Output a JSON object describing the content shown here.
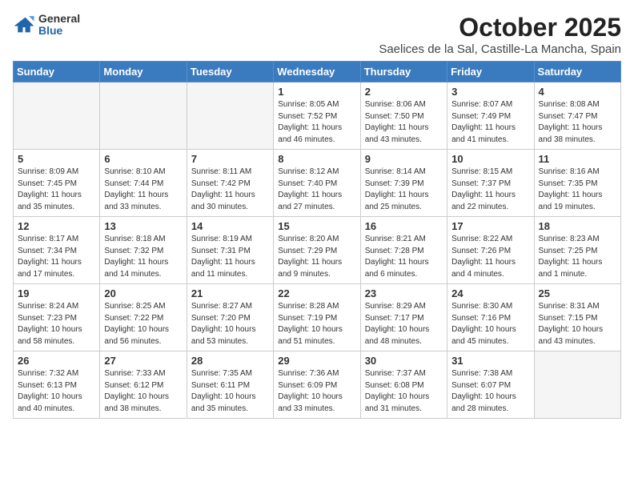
{
  "header": {
    "logo_general": "General",
    "logo_blue": "Blue",
    "month": "October 2025",
    "location": "Saelices de la Sal, Castille-La Mancha, Spain"
  },
  "weekdays": [
    "Sunday",
    "Monday",
    "Tuesday",
    "Wednesday",
    "Thursday",
    "Friday",
    "Saturday"
  ],
  "rows": [
    [
      {
        "day": "",
        "info": ""
      },
      {
        "day": "",
        "info": ""
      },
      {
        "day": "",
        "info": ""
      },
      {
        "day": "1",
        "info": "Sunrise: 8:05 AM\nSunset: 7:52 PM\nDaylight: 11 hours\nand 46 minutes."
      },
      {
        "day": "2",
        "info": "Sunrise: 8:06 AM\nSunset: 7:50 PM\nDaylight: 11 hours\nand 43 minutes."
      },
      {
        "day": "3",
        "info": "Sunrise: 8:07 AM\nSunset: 7:49 PM\nDaylight: 11 hours\nand 41 minutes."
      },
      {
        "day": "4",
        "info": "Sunrise: 8:08 AM\nSunset: 7:47 PM\nDaylight: 11 hours\nand 38 minutes."
      }
    ],
    [
      {
        "day": "5",
        "info": "Sunrise: 8:09 AM\nSunset: 7:45 PM\nDaylight: 11 hours\nand 35 minutes."
      },
      {
        "day": "6",
        "info": "Sunrise: 8:10 AM\nSunset: 7:44 PM\nDaylight: 11 hours\nand 33 minutes."
      },
      {
        "day": "7",
        "info": "Sunrise: 8:11 AM\nSunset: 7:42 PM\nDaylight: 11 hours\nand 30 minutes."
      },
      {
        "day": "8",
        "info": "Sunrise: 8:12 AM\nSunset: 7:40 PM\nDaylight: 11 hours\nand 27 minutes."
      },
      {
        "day": "9",
        "info": "Sunrise: 8:14 AM\nSunset: 7:39 PM\nDaylight: 11 hours\nand 25 minutes."
      },
      {
        "day": "10",
        "info": "Sunrise: 8:15 AM\nSunset: 7:37 PM\nDaylight: 11 hours\nand 22 minutes."
      },
      {
        "day": "11",
        "info": "Sunrise: 8:16 AM\nSunset: 7:35 PM\nDaylight: 11 hours\nand 19 minutes."
      }
    ],
    [
      {
        "day": "12",
        "info": "Sunrise: 8:17 AM\nSunset: 7:34 PM\nDaylight: 11 hours\nand 17 minutes."
      },
      {
        "day": "13",
        "info": "Sunrise: 8:18 AM\nSunset: 7:32 PM\nDaylight: 11 hours\nand 14 minutes."
      },
      {
        "day": "14",
        "info": "Sunrise: 8:19 AM\nSunset: 7:31 PM\nDaylight: 11 hours\nand 11 minutes."
      },
      {
        "day": "15",
        "info": "Sunrise: 8:20 AM\nSunset: 7:29 PM\nDaylight: 11 hours\nand 9 minutes."
      },
      {
        "day": "16",
        "info": "Sunrise: 8:21 AM\nSunset: 7:28 PM\nDaylight: 11 hours\nand 6 minutes."
      },
      {
        "day": "17",
        "info": "Sunrise: 8:22 AM\nSunset: 7:26 PM\nDaylight: 11 hours\nand 4 minutes."
      },
      {
        "day": "18",
        "info": "Sunrise: 8:23 AM\nSunset: 7:25 PM\nDaylight: 11 hours\nand 1 minute."
      }
    ],
    [
      {
        "day": "19",
        "info": "Sunrise: 8:24 AM\nSunset: 7:23 PM\nDaylight: 10 hours\nand 58 minutes."
      },
      {
        "day": "20",
        "info": "Sunrise: 8:25 AM\nSunset: 7:22 PM\nDaylight: 10 hours\nand 56 minutes."
      },
      {
        "day": "21",
        "info": "Sunrise: 8:27 AM\nSunset: 7:20 PM\nDaylight: 10 hours\nand 53 minutes."
      },
      {
        "day": "22",
        "info": "Sunrise: 8:28 AM\nSunset: 7:19 PM\nDaylight: 10 hours\nand 51 minutes."
      },
      {
        "day": "23",
        "info": "Sunrise: 8:29 AM\nSunset: 7:17 PM\nDaylight: 10 hours\nand 48 minutes."
      },
      {
        "day": "24",
        "info": "Sunrise: 8:30 AM\nSunset: 7:16 PM\nDaylight: 10 hours\nand 45 minutes."
      },
      {
        "day": "25",
        "info": "Sunrise: 8:31 AM\nSunset: 7:15 PM\nDaylight: 10 hours\nand 43 minutes."
      }
    ],
    [
      {
        "day": "26",
        "info": "Sunrise: 7:32 AM\nSunset: 6:13 PM\nDaylight: 10 hours\nand 40 minutes."
      },
      {
        "day": "27",
        "info": "Sunrise: 7:33 AM\nSunset: 6:12 PM\nDaylight: 10 hours\nand 38 minutes."
      },
      {
        "day": "28",
        "info": "Sunrise: 7:35 AM\nSunset: 6:11 PM\nDaylight: 10 hours\nand 35 minutes."
      },
      {
        "day": "29",
        "info": "Sunrise: 7:36 AM\nSunset: 6:09 PM\nDaylight: 10 hours\nand 33 minutes."
      },
      {
        "day": "30",
        "info": "Sunrise: 7:37 AM\nSunset: 6:08 PM\nDaylight: 10 hours\nand 31 minutes."
      },
      {
        "day": "31",
        "info": "Sunrise: 7:38 AM\nSunset: 6:07 PM\nDaylight: 10 hours\nand 28 minutes."
      },
      {
        "day": "",
        "info": ""
      }
    ]
  ],
  "shaded_rows": [
    1,
    3
  ]
}
